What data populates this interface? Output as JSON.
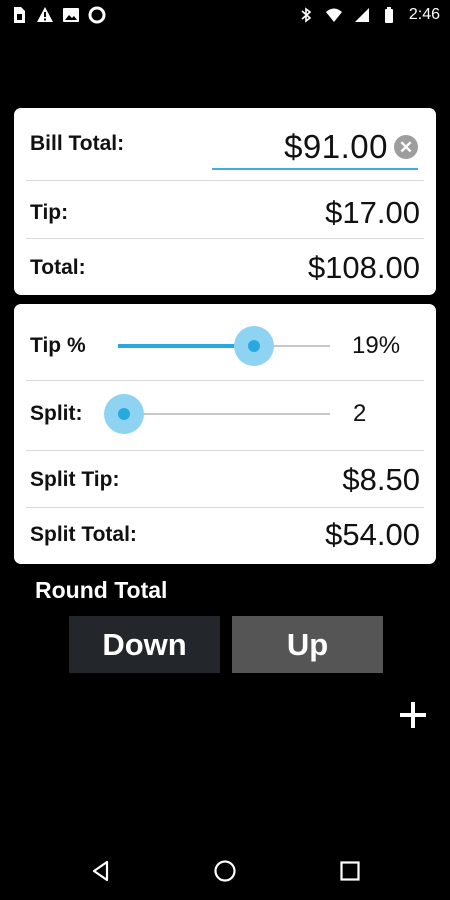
{
  "status_bar": {
    "time": "2:46",
    "left_icons": [
      "sim-card-icon",
      "warning-icon",
      "image-icon",
      "circle-notification-icon"
    ],
    "right_icons": [
      "bluetooth-icon",
      "wifi-icon",
      "signal-icon",
      "battery-icon"
    ]
  },
  "bill": {
    "label": "Bill Total:",
    "value": "$91.00"
  },
  "tip": {
    "label": "Tip:",
    "value": "$17.00"
  },
  "total": {
    "label": "Total:",
    "value": "$108.00"
  },
  "tip_percent": {
    "label": "Tip %",
    "value_text": "19%",
    "slider_fraction": 0.64
  },
  "split": {
    "label": "Split:",
    "value_text": "2",
    "slider_fraction": 0.03
  },
  "split_tip": {
    "label": "Split Tip:",
    "value": "$8.50"
  },
  "split_total": {
    "label": "Split Total:",
    "value": "$54.00"
  },
  "round_total": {
    "title": "Round Total",
    "down_label": "Down",
    "up_label": "Up"
  },
  "colors": {
    "accent": "#29a8e0",
    "accent_halo": "#8fd3f2",
    "background": "#000000",
    "card": "#ffffff",
    "round_down": "#23272b",
    "round_up": "#555555"
  }
}
